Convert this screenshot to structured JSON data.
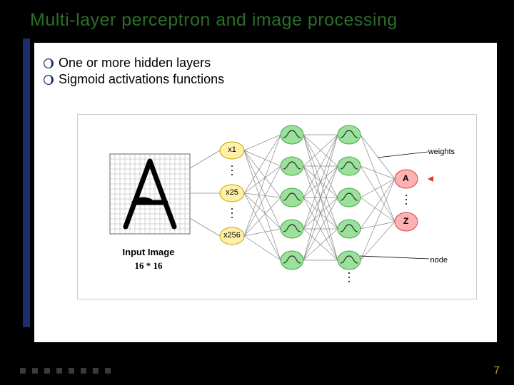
{
  "title": "Multi-layer perceptron and image processing",
  "bullets": {
    "b1": "One or more hidden layers",
    "b2": "Sigmoid activations functions"
  },
  "diagram": {
    "input_label": "Input Image",
    "input_dim": "16 * 16",
    "x1": "x1",
    "x25": "x25",
    "x256": "x256",
    "weights": "weights",
    "node": "node",
    "outA": "A",
    "outZ": "Z"
  },
  "page_number": "7"
}
